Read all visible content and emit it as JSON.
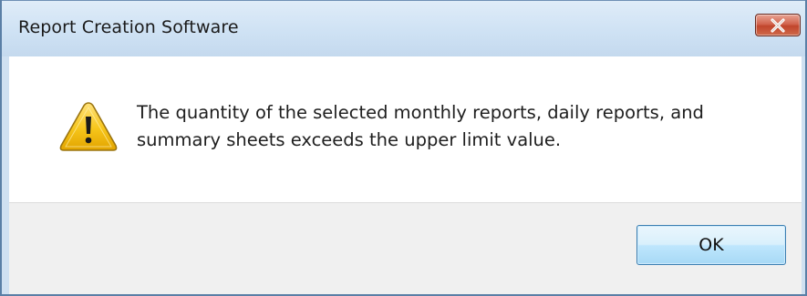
{
  "dialog": {
    "title": "Report Creation Software",
    "message": "The quantity of the selected monthly reports, daily reports, and summary sheets exceeds the upper limit value.",
    "ok_label": "OK",
    "icon": "warning-icon",
    "close_icon": "close-icon"
  },
  "colors": {
    "titlebar": "#cfe2f4",
    "close_button": "#c1452d",
    "footer": "#f0f0f0",
    "ok_border": "#3c7fb1",
    "warning_fill": "#f5c400"
  }
}
